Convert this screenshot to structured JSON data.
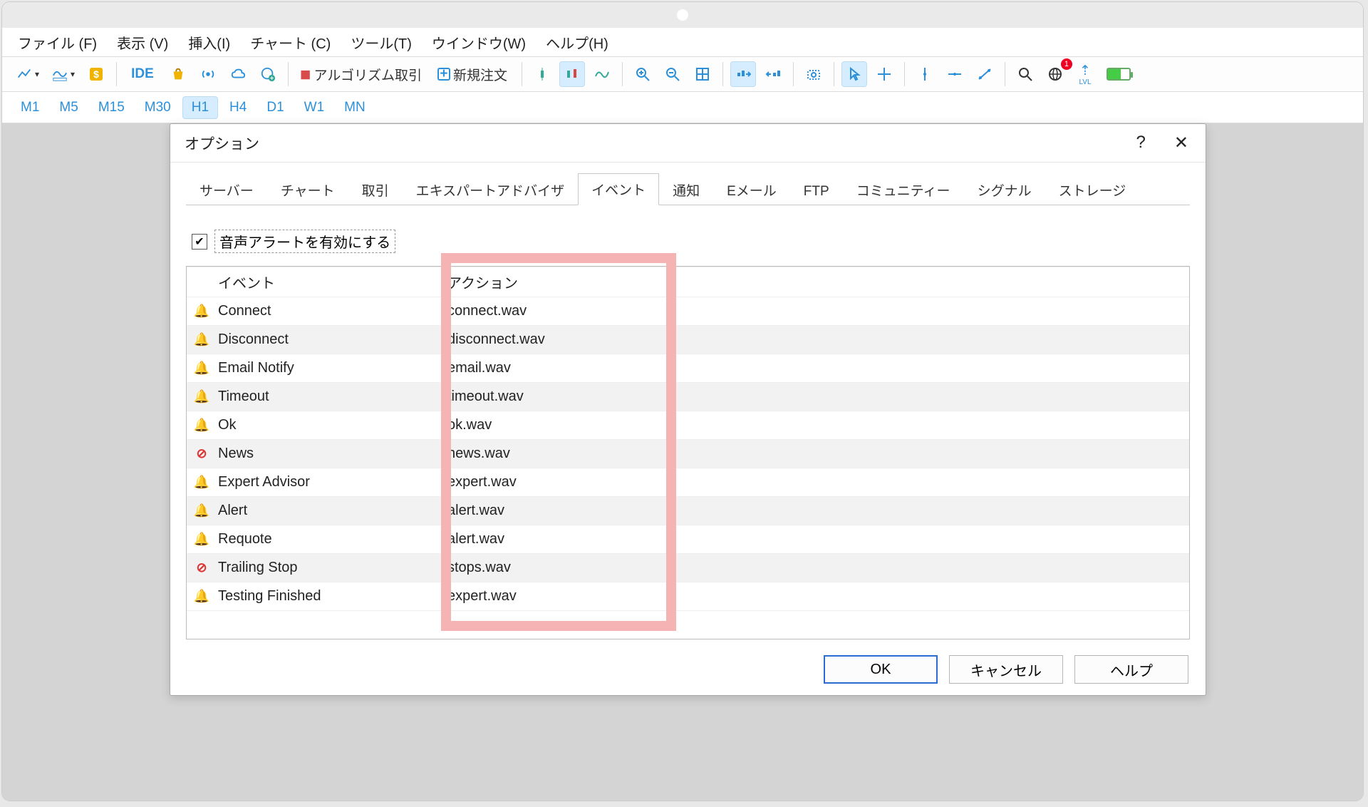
{
  "menu": {
    "file": "ファイル (F)",
    "view": "表示 (V)",
    "insert": "挿入(I)",
    "chart": "チャート (C)",
    "tools": "ツール(T)",
    "window": "ウインドウ(W)",
    "help": "ヘルプ(H)"
  },
  "toolbar": {
    "ide": "IDE",
    "algo": "アルゴリズム取引",
    "neworder": "新規注文"
  },
  "timeframes": [
    "M1",
    "M5",
    "M15",
    "M30",
    "H1",
    "H4",
    "D1",
    "W1",
    "MN"
  ],
  "dialog": {
    "title": "オプション",
    "help_icon": "?",
    "close_icon": "✕",
    "tabs": [
      "サーバー",
      "チャート",
      "取引",
      "エキスパートアドバイザ",
      "イベント",
      "通知",
      "Eメール",
      "FTP",
      "コミュニティー",
      "シグナル",
      "ストレージ"
    ],
    "checkbox_label": "音声アラートを有効にする",
    "table": {
      "headers": {
        "event": "イベント",
        "action": "アクション"
      },
      "rows": [
        {
          "icon": "bell",
          "event": "Connect",
          "action": "connect.wav"
        },
        {
          "icon": "bell",
          "event": "Disconnect",
          "action": "disconnect.wav"
        },
        {
          "icon": "bell",
          "event": "Email Notify",
          "action": "email.wav"
        },
        {
          "icon": "bell",
          "event": "Timeout",
          "action": "timeout.wav"
        },
        {
          "icon": "bell",
          "event": "Ok",
          "action": "ok.wav"
        },
        {
          "icon": "nope",
          "event": "News",
          "action": "news.wav"
        },
        {
          "icon": "bell",
          "event": "Expert Advisor",
          "action": "expert.wav"
        },
        {
          "icon": "bell",
          "event": "Alert",
          "action": "alert.wav"
        },
        {
          "icon": "bell",
          "event": "Requote",
          "action": "alert.wav"
        },
        {
          "icon": "nope",
          "event": "Trailing Stop",
          "action": "stops.wav"
        },
        {
          "icon": "bell",
          "event": "Testing Finished",
          "action": "expert.wav"
        }
      ]
    },
    "buttons": {
      "ok": "OK",
      "cancel": "キャンセル",
      "help": "ヘルプ"
    }
  }
}
